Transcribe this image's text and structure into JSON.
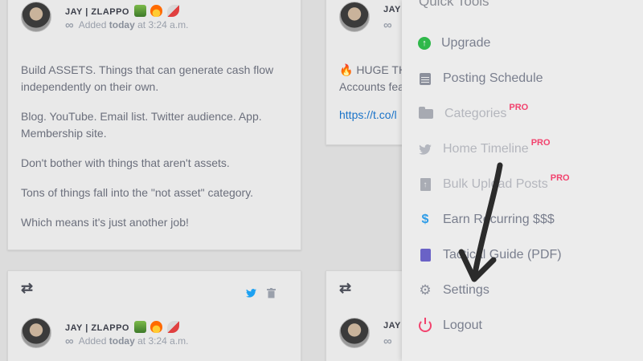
{
  "posts": [
    {
      "author": "JAY | ZLAPPO",
      "added_prefix": "Added",
      "added_when": "today",
      "added_time": "at 3:24 a.m.",
      "paragraphs": [
        "Build ASSETS. Things that can generate cash flow independently on their own.",
        "Blog. YouTube. Email list. Twitter audience. App. Membership site.",
        "Don't bother with things that aren't assets.",
        "Tons of things fall into the \"not asset\" category.",
        "Which means it's just another job!"
      ]
    },
    {
      "author": "JAY",
      "text_line1": "🔥 HUGE TH",
      "text_line2": "Accounts fea",
      "link": "https://t.co/l"
    },
    {
      "author": "JAY | ZLAPPO",
      "added_prefix": "Added",
      "added_when": "today",
      "added_time": "at 3:24 a.m."
    },
    {
      "author": "JAY"
    }
  ],
  "icons": {
    "retweet": "⇄",
    "twitter": "🐦",
    "trash": "🗑",
    "infinity": "∞"
  },
  "quick_tools": {
    "title": "Quick Tools",
    "items": [
      {
        "label": "Upgrade",
        "icon": "upgrade-icon",
        "pro": false
      },
      {
        "label": "Posting Schedule",
        "icon": "calendar-icon",
        "pro": false
      },
      {
        "label": "Categories",
        "icon": "folder-icon",
        "pro": true
      },
      {
        "label": "Home Timeline",
        "icon": "twitter-icon",
        "pro": true
      },
      {
        "label": "Bulk Upload Posts",
        "icon": "upload-file-icon",
        "pro": true
      },
      {
        "label": "Earn Recurring $$$",
        "icon": "hand-dollar-icon",
        "pro": false
      },
      {
        "label": "Tactical Guide (PDF)",
        "icon": "book-icon",
        "pro": false
      },
      {
        "label": "Settings",
        "icon": "gear-icon",
        "pro": false
      },
      {
        "label": "Logout",
        "icon": "power-icon",
        "pro": false
      }
    ],
    "pro_badge": "PRO"
  },
  "colors": {
    "pro": "#f2436e",
    "upgrade": "#2fb84a",
    "link": "#1a73c8",
    "twitter": "#1da1f2"
  }
}
